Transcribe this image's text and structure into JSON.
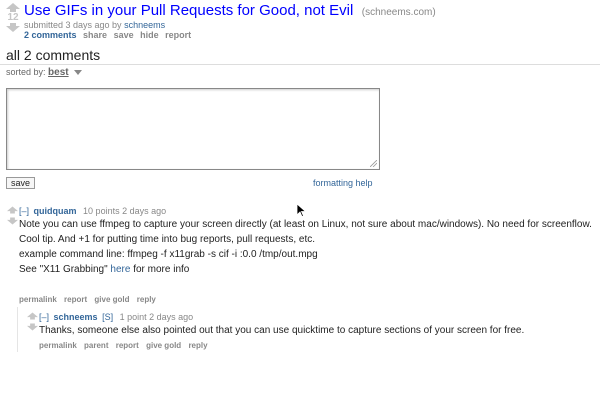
{
  "post": {
    "score": "12",
    "title": "Use GIFs in your Pull Requests for Good, not Evil",
    "domain": "(schneems.com)",
    "tagline_prefix": "submitted 3 days ago by",
    "author": "schneems",
    "buttons": [
      "2 comments",
      "share",
      "save",
      "hide",
      "report"
    ]
  },
  "comments_area": {
    "heading": "all 2 comments",
    "sorted_by_label": "sorted by:",
    "sorted_by_value": "best",
    "save_label": "save",
    "formatting_help": "formatting help"
  },
  "comments": [
    {
      "expand": "[–]",
      "author": "quidquam",
      "meta": "10 points 2 days ago",
      "paragraphs": [
        "Note you can use ffmpeg to capture your screen directly (at least on Linux, not sure about mac/windows). No need for screenflow.",
        "Cool tip. And +1 for putting time into bug reports, pull requests, etc.",
        "example command line: ffmpeg -f x11grab -s cif -i :0.0 /tmp/out.mpg"
      ],
      "last_para_prefix": "See \"X11 Grabbing\"",
      "last_para_link": "here",
      "last_para_suffix": "for more info",
      "buttons": [
        "permalink",
        "report",
        "give gold",
        "reply"
      ]
    },
    {
      "expand": "[–]",
      "author": "schneems",
      "submitter_tag": "[S]",
      "meta": "1 point 2 days ago",
      "paragraphs": [
        "Thanks, someone else also pointed out that you can use quicktime to capture sections of your screen for free."
      ],
      "buttons": [
        "permalink",
        "parent",
        "report",
        "give gold",
        "reply"
      ]
    }
  ],
  "colors": {
    "link": "#0000ff",
    "author": "#336699",
    "muted": "#888888"
  }
}
